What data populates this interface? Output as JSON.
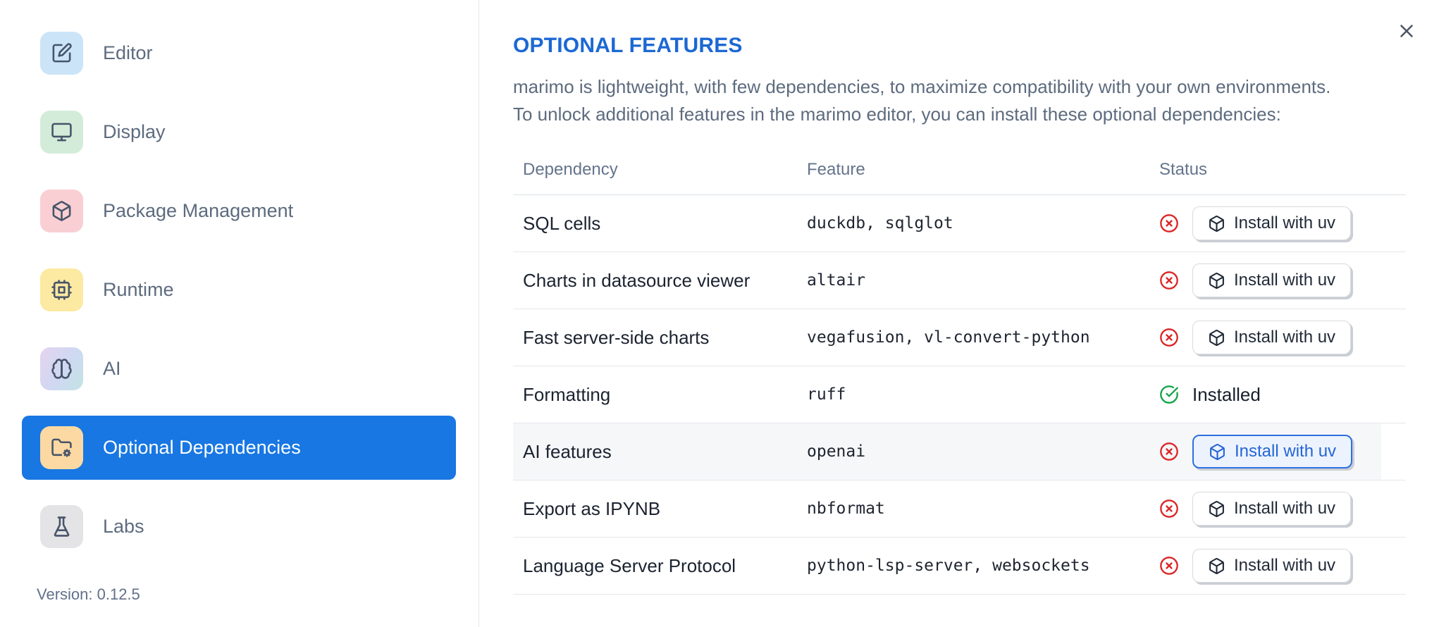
{
  "sidebar": {
    "items": [
      {
        "label": "Editor",
        "icon": "edit-icon"
      },
      {
        "label": "Display",
        "icon": "monitor-icon"
      },
      {
        "label": "Package Management",
        "icon": "package-icon"
      },
      {
        "label": "Runtime",
        "icon": "cpu-icon"
      },
      {
        "label": "AI",
        "icon": "brain-icon"
      },
      {
        "label": "Optional Dependencies",
        "icon": "folder-cog-icon",
        "selected": true
      },
      {
        "label": "Labs",
        "icon": "flask-icon"
      }
    ],
    "version": "Version: 0.12.5"
  },
  "main": {
    "title": "OPTIONAL FEATURES",
    "description_line1": "marimo is lightweight, with few dependencies, to maximize compatibility with your own environments.",
    "description_line2": "To unlock additional features in the marimo editor, you can install these optional dependencies:",
    "close_icon": "x-icon",
    "table": {
      "columns": [
        "Dependency",
        "Feature",
        "Status"
      ],
      "install_button_label": "Install with uv",
      "installed_label": "Installed",
      "rows": [
        {
          "dependency": "SQL cells",
          "feature": "duckdb, sqlglot",
          "status": "not-installed"
        },
        {
          "dependency": "Charts in datasource viewer",
          "feature": "altair",
          "status": "not-installed"
        },
        {
          "dependency": "Fast server-side charts",
          "feature": "vegafusion, vl-convert-python",
          "status": "not-installed"
        },
        {
          "dependency": "Formatting",
          "feature": "ruff",
          "status": "installed"
        },
        {
          "dependency": "AI features",
          "feature": "openai",
          "status": "not-installed",
          "highlighted": true
        },
        {
          "dependency": "Export as IPYNB",
          "feature": "nbformat",
          "status": "not-installed"
        },
        {
          "dependency": "Language Server Protocol",
          "feature": "python-lsp-server, websockets",
          "status": "not-installed"
        }
      ]
    }
  },
  "colors": {
    "accent_blue": "#1877e2",
    "title_blue": "#1c68d4",
    "error_red": "#dc2626",
    "success_green": "#16a34a",
    "focused_button_blue": "#2465d6"
  }
}
